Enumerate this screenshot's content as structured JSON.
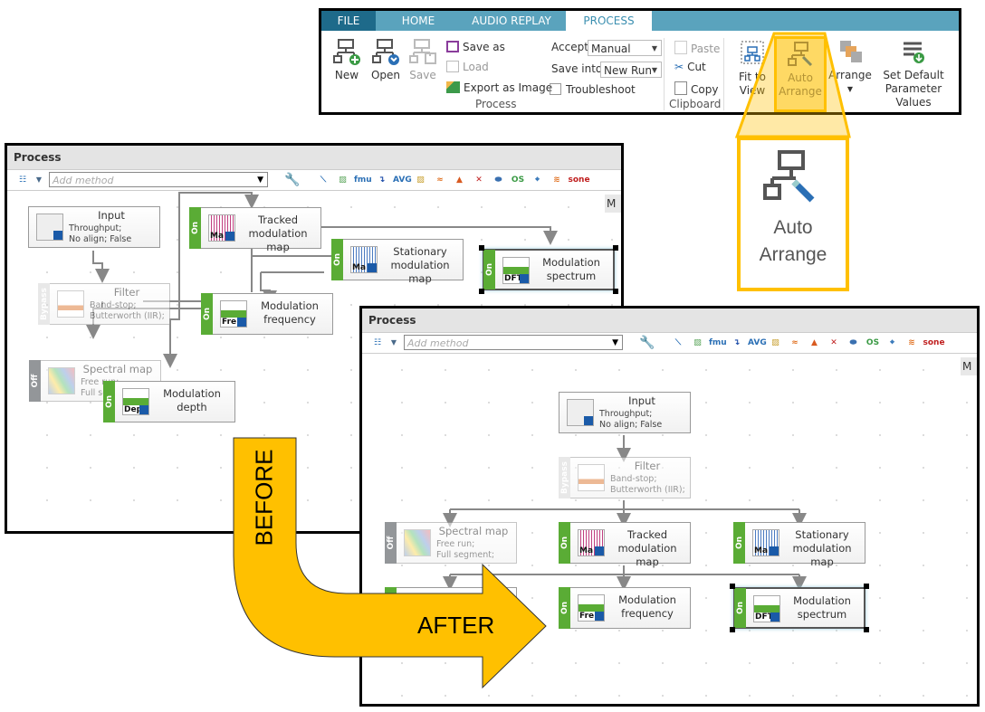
{
  "ribbon": {
    "tabs": [
      {
        "label": "FILE"
      },
      {
        "label": "HOME"
      },
      {
        "label": "AUDIO REPLAY"
      },
      {
        "label": "PROCESS",
        "active": true
      }
    ],
    "process_group": {
      "new_label": "New",
      "open_label": "Open",
      "save_label": "Save",
      "save_as_label": "Save as",
      "load_label": "Load",
      "export_label": "Export as Image",
      "group_label": "Process"
    },
    "accept": {
      "label": "Accept",
      "value": "Manual"
    },
    "save_into": {
      "label": "Save into",
      "value": "New Run"
    },
    "troubleshoot": {
      "label": "Troubleshoot",
      "checked": false
    },
    "clipboard": {
      "paste_label": "Paste",
      "cut_label": "Cut",
      "copy_label": "Copy",
      "group_label": "Clipboard"
    },
    "fit_to_view_label": "Fit to View",
    "auto_arrange_label": "Auto Arrange",
    "arrange_label": "Arrange",
    "set_default_label": "Set Default Parameter Values"
  },
  "callout": {
    "label": "Auto Arrange",
    "highlight_color": "#ffc000"
  },
  "panels": {
    "title": "Process",
    "add_method_placeholder": "Add method",
    "side_tab": "M",
    "toolbar_icons": [
      "filter-design-icon",
      "spectrogram-icon",
      "fmu-icon",
      "redirect-icon",
      "average-icon",
      "spectral-map-icon",
      "filter-icon",
      "matlab-icon",
      "crosstalk-icon",
      "python-icon",
      "order-spectrum-icon",
      "location-icon",
      "filter-bank-icon",
      "sone-icon"
    ]
  },
  "nodes": {
    "input": {
      "title": "Input",
      "sub1": "Throughput;",
      "sub2": "No align; False"
    },
    "filter": {
      "title": "Filter",
      "status": "Bypass",
      "sub1": "Band-stop;",
      "sub2": "Butterworth (IIR);"
    },
    "spectral_map": {
      "title": "Spectral map",
      "status": "Off",
      "sub1": "Free run;",
      "sub2": "Full segment;"
    },
    "tracked_map": {
      "title": "Tracked modulation map",
      "status": "On",
      "thumb": "Ma"
    },
    "stationary_map": {
      "title": "Stationary modulation map",
      "status": "On",
      "thumb": "Ma"
    },
    "mod_frequency": {
      "title": "Modulation frequency",
      "status": "On",
      "thumb": "Fre"
    },
    "mod_spectrum": {
      "title": "Modulation spectrum",
      "status": "On",
      "thumb": "DFT"
    },
    "mod_depth": {
      "title": "Modulation depth",
      "status": "On",
      "thumb": "Dep"
    }
  },
  "arrow": {
    "before_label": "BEFORE",
    "after_label": "AFTER",
    "color": "#ffc000"
  }
}
